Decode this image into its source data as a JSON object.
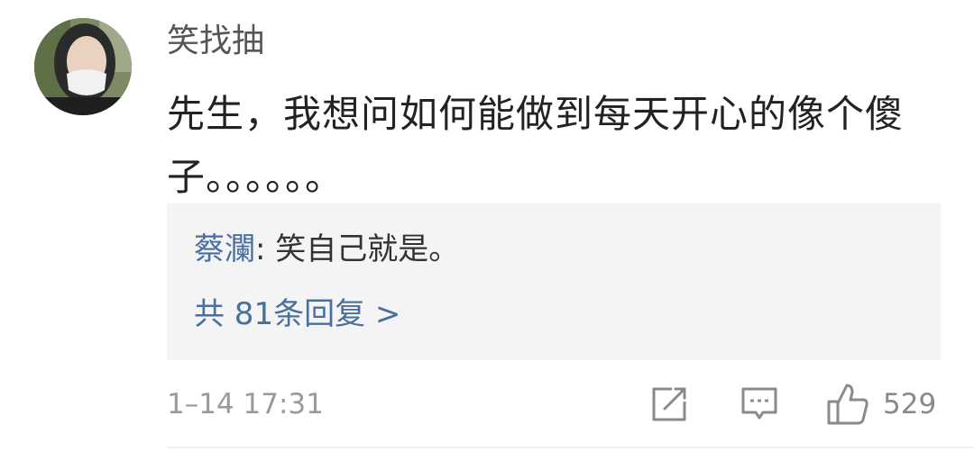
{
  "comment": {
    "username": "笑找抽",
    "text": "先生，我想问如何能做到每天开心的像个傻子。。。。。。",
    "reply": {
      "author": "蔡瀾",
      "separator": ": ",
      "text": "笑自己就是。",
      "count_label": "共 81条回复 >"
    },
    "timestamp": "1–14 17:31",
    "like_count": "529"
  },
  "icons": {
    "share": "share-icon",
    "comment": "comment-icon",
    "like": "thumbs-up-icon"
  },
  "colors": {
    "link": "#4a6f9e",
    "reply_background": "#f4f4f4",
    "meta_text": "#9a9a9a"
  }
}
